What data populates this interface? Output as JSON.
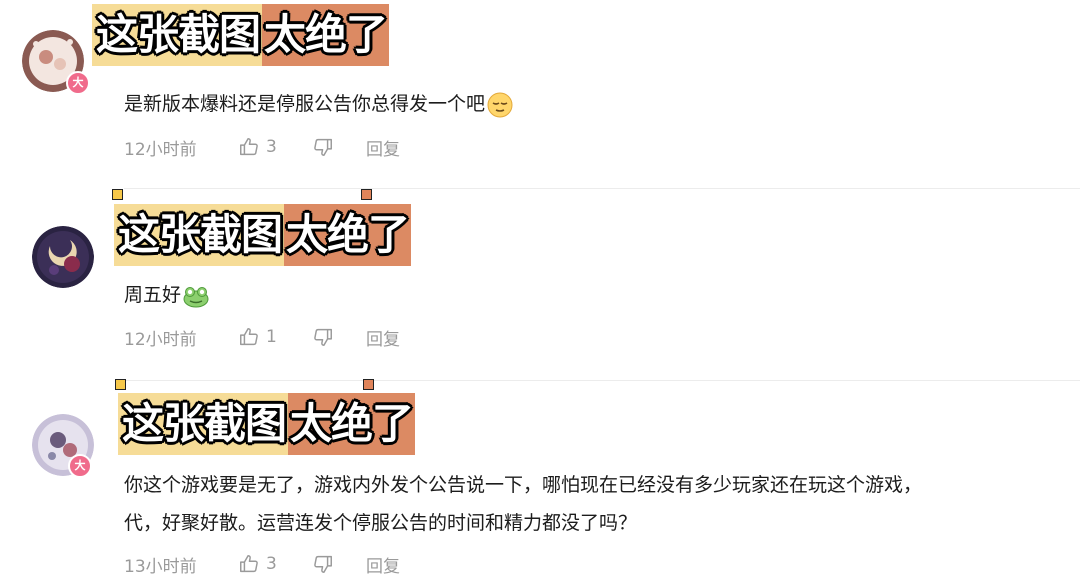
{
  "overlay": {
    "part1": "这张截图",
    "part2": "太绝了"
  },
  "comments": [
    {
      "badge": "大",
      "text": "是新版本爆料还是停服公告你总得发一个吧",
      "emoji": "relieved-face-emoji",
      "time": "12小时前",
      "likes": "3",
      "reply": "回复"
    },
    {
      "badge": "",
      "text": "周五好",
      "emoji": "frog-emoji",
      "time": "12小时前",
      "likes": "1",
      "reply": "回复"
    },
    {
      "badge": "大",
      "text_line1": "你这个游戏要是无了，游戏内外发个公告说一下，哪怕现在已经没有多少玩家还在玩这个游戏，",
      "text_line2": "代，好聚好散。运营连发个停服公告的时间和精力都没了吗？",
      "time": "13小时前",
      "likes": "3",
      "reply": "回复"
    }
  ],
  "colors": {
    "badge": "#f06b8b",
    "overlay_left": "#f6dc97",
    "overlay_right": "#dc8a63",
    "meta": "#9a9a9a"
  }
}
